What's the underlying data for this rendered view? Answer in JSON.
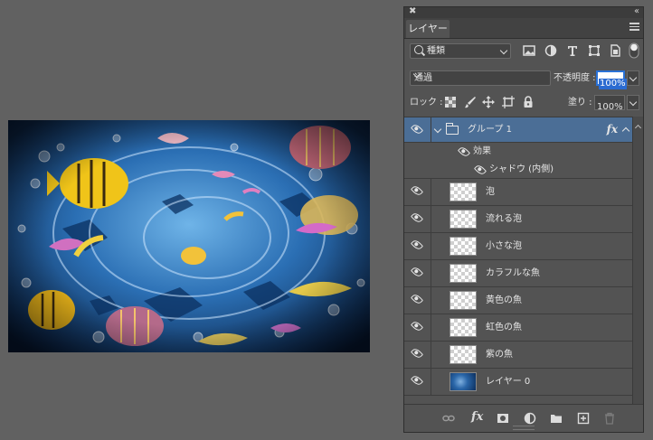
{
  "panel": {
    "close_label": "✖",
    "collapse_label": "‹‹",
    "tab_label": "レイヤー",
    "filter_kind": "種類",
    "blend_mode": "通過",
    "opacity_label": "不透明度 :",
    "opacity_value": "100%",
    "lock_label": "ロック :",
    "fill_label": "塗り :",
    "fill_value": "100%"
  },
  "group": {
    "name": "グループ 1",
    "fx_label": "fx",
    "effects_label": "効果",
    "effect_name": "シャドウ (内側)"
  },
  "layers": [
    {
      "name": "泡",
      "thumb": "transparent"
    },
    {
      "name": "流れる泡",
      "thumb": "transparent"
    },
    {
      "name": "小さな泡",
      "thumb": "transparent"
    },
    {
      "name": "カラフルな魚",
      "thumb": "transparent"
    },
    {
      "name": "黄色の魚",
      "thumb": "transparent"
    },
    {
      "name": "虹色の魚",
      "thumb": "transparent"
    },
    {
      "name": "紫の魚",
      "thumb": "transparent"
    },
    {
      "name": "レイヤー 0",
      "thumb": "image"
    }
  ],
  "footer": {
    "fx_label": "fx"
  }
}
